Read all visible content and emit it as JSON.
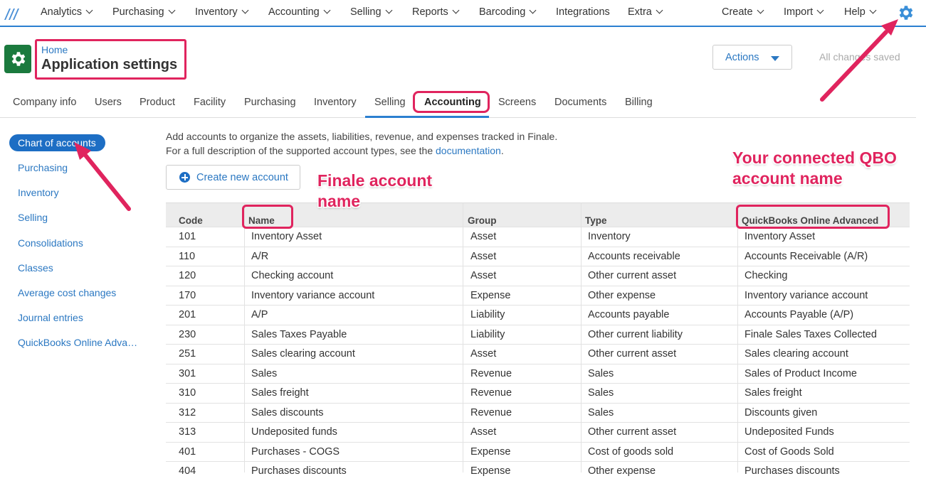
{
  "nav": {
    "items": [
      {
        "label": "Analytics",
        "dropdown": true
      },
      {
        "label": "Purchasing",
        "dropdown": true
      },
      {
        "label": "Inventory",
        "dropdown": true
      },
      {
        "label": "Accounting",
        "dropdown": true
      },
      {
        "label": "Selling",
        "dropdown": true
      },
      {
        "label": "Reports",
        "dropdown": true
      },
      {
        "label": "Barcoding",
        "dropdown": true
      },
      {
        "label": "Integrations",
        "dropdown": false
      },
      {
        "label": "Extra",
        "dropdown": true
      }
    ],
    "right_items": [
      {
        "label": "Create",
        "dropdown": true
      },
      {
        "label": "Import",
        "dropdown": true
      },
      {
        "label": "Help",
        "dropdown": true
      }
    ],
    "settings_icon": "gear-icon"
  },
  "header": {
    "breadcrumb": "Home",
    "title": "Application settings",
    "actions_label": "Actions",
    "status": "All changes saved"
  },
  "tabs": [
    "Company info",
    "Users",
    "Product",
    "Facility",
    "Purchasing",
    "Inventory",
    "Selling",
    "Accounting",
    "Screens",
    "Documents",
    "Billing"
  ],
  "active_tab": "Accounting",
  "sidebar": {
    "active": "Chart of accounts",
    "items": [
      "Purchasing",
      "Inventory",
      "Selling",
      "Consolidations",
      "Classes",
      "Average cost changes",
      "Journal entries",
      "QuickBooks Online Adva…"
    ]
  },
  "content": {
    "desc_line1": "Add accounts to organize the assets, liabilities, revenue, and expenses tracked in Finale.",
    "desc_line2_prefix": "For a full description of the supported account types, see the ",
    "desc_link": "documentation",
    "desc_line2_suffix": ".",
    "create_button": "Create new account"
  },
  "table": {
    "headers": [
      "Code",
      "Name",
      "Group",
      "Type",
      "QuickBooks Online Advanced"
    ],
    "rows": [
      [
        "101",
        "Inventory Asset",
        "Asset",
        "Inventory",
        "Inventory Asset"
      ],
      [
        "110",
        "A/R",
        "Asset",
        "Accounts receivable",
        "Accounts Receivable (A/R)"
      ],
      [
        "120",
        "Checking account",
        "Asset",
        "Other current asset",
        "Checking"
      ],
      [
        "170",
        "Inventory variance account",
        "Expense",
        "Other expense",
        "Inventory variance account"
      ],
      [
        "201",
        "A/P",
        "Liability",
        "Accounts payable",
        "Accounts Payable (A/P)"
      ],
      [
        "230",
        "Sales Taxes Payable",
        "Liability",
        "Other current liability",
        "Finale Sales Taxes Collected"
      ],
      [
        "251",
        "Sales clearing account",
        "Asset",
        "Other current asset",
        "Sales clearing account"
      ],
      [
        "301",
        "Sales",
        "Revenue",
        "Sales",
        "Sales of Product Income"
      ],
      [
        "310",
        "Sales freight",
        "Revenue",
        "Sales",
        "Sales freight"
      ],
      [
        "312",
        "Sales discounts",
        "Revenue",
        "Sales",
        "Discounts given"
      ],
      [
        "313",
        "Undeposited funds",
        "Asset",
        "Other current asset",
        "Undeposited Funds"
      ],
      [
        "401",
        "Purchases - COGS",
        "Expense",
        "Cost of goods sold",
        "Cost of Goods Sold"
      ],
      [
        "404",
        "Purchases discounts",
        "Expense",
        "Other expense",
        "Purchases discounts"
      ]
    ]
  },
  "annotations": {
    "finale_line1": "Finale account",
    "finale_line2": "name",
    "qbo_line1": "Your connected QBO",
    "qbo_line2": "account name",
    "color": "#e0245e"
  },
  "colors": {
    "accent": "#2b7fd0",
    "sidebar_active": "#1d6ec4",
    "app_icon": "#1b7a3e"
  }
}
